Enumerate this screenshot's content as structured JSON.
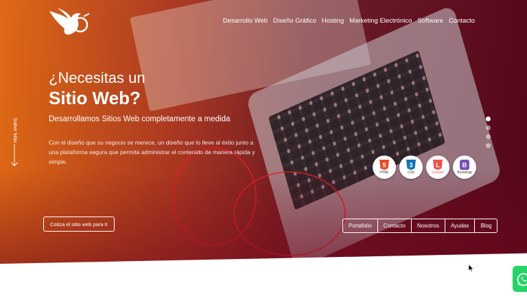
{
  "brand": {
    "logo_icon": "hummingbird-logo-icon"
  },
  "nav": {
    "items": [
      {
        "label": "Desarrollo Web"
      },
      {
        "label": "Diseño Gráfico"
      },
      {
        "label": "Hosting"
      },
      {
        "label": "Marketing Electrónico"
      },
      {
        "label": "Software"
      },
      {
        "label": "Contacto"
      }
    ]
  },
  "hero": {
    "headline_line1": "¿Necesitas un",
    "headline_line2": "Sitio Web?",
    "subtitle": "Desarrollamos Sitios Web completamente a medida",
    "description": "Con el diseño que su negocio se merece, un diseño que lo lleve al éxito junto a una plataforma segura que permita administrar el contenido de manera rápida y simple.",
    "side_link": "Saber Más",
    "cta_label": "Cotiza el sitio web para tí"
  },
  "tech_badges": [
    {
      "glyph": "5",
      "caption": "HTML",
      "color": "#e44d26",
      "icon": "html5-icon"
    },
    {
      "glyph": "3",
      "caption": "CSS",
      "color": "#1572b6",
      "icon": "css3-icon"
    },
    {
      "glyph": "L",
      "caption": "Laravel",
      "color": "#f0524f",
      "icon": "laravel-icon"
    },
    {
      "glyph": "B",
      "caption": "Bootstrap",
      "color": "#7952b3",
      "icon": "bootstrap-icon"
    }
  ],
  "quick_links": [
    {
      "label": "Portafolio"
    },
    {
      "label": "Contacto"
    },
    {
      "label": "Nosotros"
    },
    {
      "label": "Ayudas"
    },
    {
      "label": "Blog"
    }
  ],
  "slider": {
    "active_index": 0,
    "total": 4
  },
  "whatsapp": {
    "icon": "whatsapp-icon",
    "color": "#25d366"
  },
  "colors": {
    "accent_orange": "#ec6e14",
    "accent_red": "#8b0a23"
  }
}
